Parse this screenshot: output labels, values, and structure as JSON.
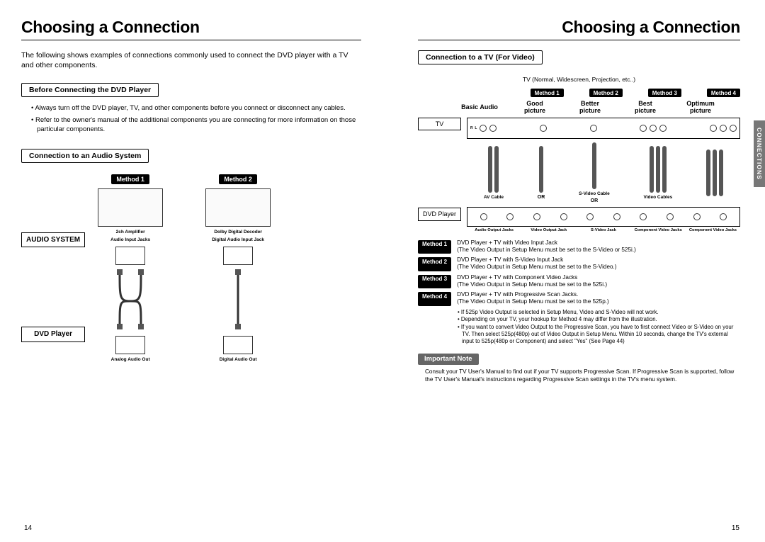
{
  "left": {
    "title": "Choosing a Connection",
    "intro": "The following shows examples of connections commonly used to connect the DVD player with a TV and other components.",
    "heading_before": "Before Connecting the DVD Player",
    "before_bullets": [
      "Always turn off the DVD player, TV, and other components before you connect or disconnect any cables.",
      "Refer to the owner's manual of the additional components you are connecting for more information on those particular components."
    ],
    "heading_audio": "Connection to an Audio System",
    "method1": "Method 1",
    "method2": "Method 2",
    "side_audio": "AUDIO SYSTEM",
    "side_dvd": "DVD Player",
    "cap_2ch": "2ch Amplifier",
    "cap_dolby": "Dolby Digital Decoder",
    "cap_ain": "Audio Input Jacks",
    "cap_din": "Digital Audio Input Jack",
    "cap_aout": "Analog Audio Out",
    "cap_dout": "Digital Audio Out",
    "page_num": "14"
  },
  "right": {
    "title": "Choosing a Connection",
    "side_tab": "CONNECTIONS",
    "heading_video": "Connection to a TV (For Video)",
    "tv_caption": "TV (Normal, Widescreen, Projection, etc..)",
    "method_tags": [
      "Method 1",
      "Method 2",
      "Method 3",
      "Method 4"
    ],
    "quality": {
      "basic": "Basic Audio",
      "good1": "Good",
      "good2": "picture",
      "better1": "Better",
      "better2": "picture",
      "best1": "Best",
      "best2": "picture",
      "opt1": "Optimum",
      "opt2": "picture"
    },
    "labels": {
      "tv": "TV",
      "dvd": "DVD Player"
    },
    "cable_labels": {
      "av": "AV Cable",
      "svideo": "S-Video Cable",
      "video": "Video Cables",
      "or": "OR"
    },
    "jack_labels": [
      "Audio Output Jacks",
      "Video Output Jack",
      "S-Video Jack",
      "Component Video Jacks",
      "Component Video Jacks"
    ],
    "methods": [
      {
        "tag": "Method 1",
        "line1": "DVD Player + TV with Video Input Jack",
        "line2": "(The Video Output in Setup Menu must be set to the S-Video or 525i.)"
      },
      {
        "tag": "Method 2",
        "line1": "DVD Player + TV with S-Video Input Jack",
        "line2": "(The Video Output in Setup Menu must be set to the S-Video.)"
      },
      {
        "tag": "Method 3",
        "line1": "DVD Player + TV with Component Video Jacks",
        "line2": "(The Video Output in Setup Menu must be set to the 525i.)"
      },
      {
        "tag": "Method 4",
        "line1": "DVD Player + TV with Progressive Scan Jacks.",
        "line2": "(The Video Output in Setup Menu must be set to the 525p.)"
      }
    ],
    "extra_notes": [
      "If 525p Video Output is selected in Setup Menu, Video and S-Video will not work.",
      "Depending on your TV, your hookup for Method 4 may differ from the illustration.",
      "If you want to convert Video Output to the Progressive Scan, you have to first connect Video or S-Video on your TV. Then select 525p(480p) out of Video Output in Setup Menu. Within 10 seconds, change the TV's external input to 525p(480p or Component) and select \"Yes\" (See Page 44)"
    ],
    "important_label": "Important Note",
    "important_text": "Consult your TV User's Manual to find out if your TV supports Progressive Scan. If Progressive Scan is supported, follow the TV User's Manual's instructions regarding Progressive Scan settings in the TV's menu system.",
    "page_num": "15"
  }
}
